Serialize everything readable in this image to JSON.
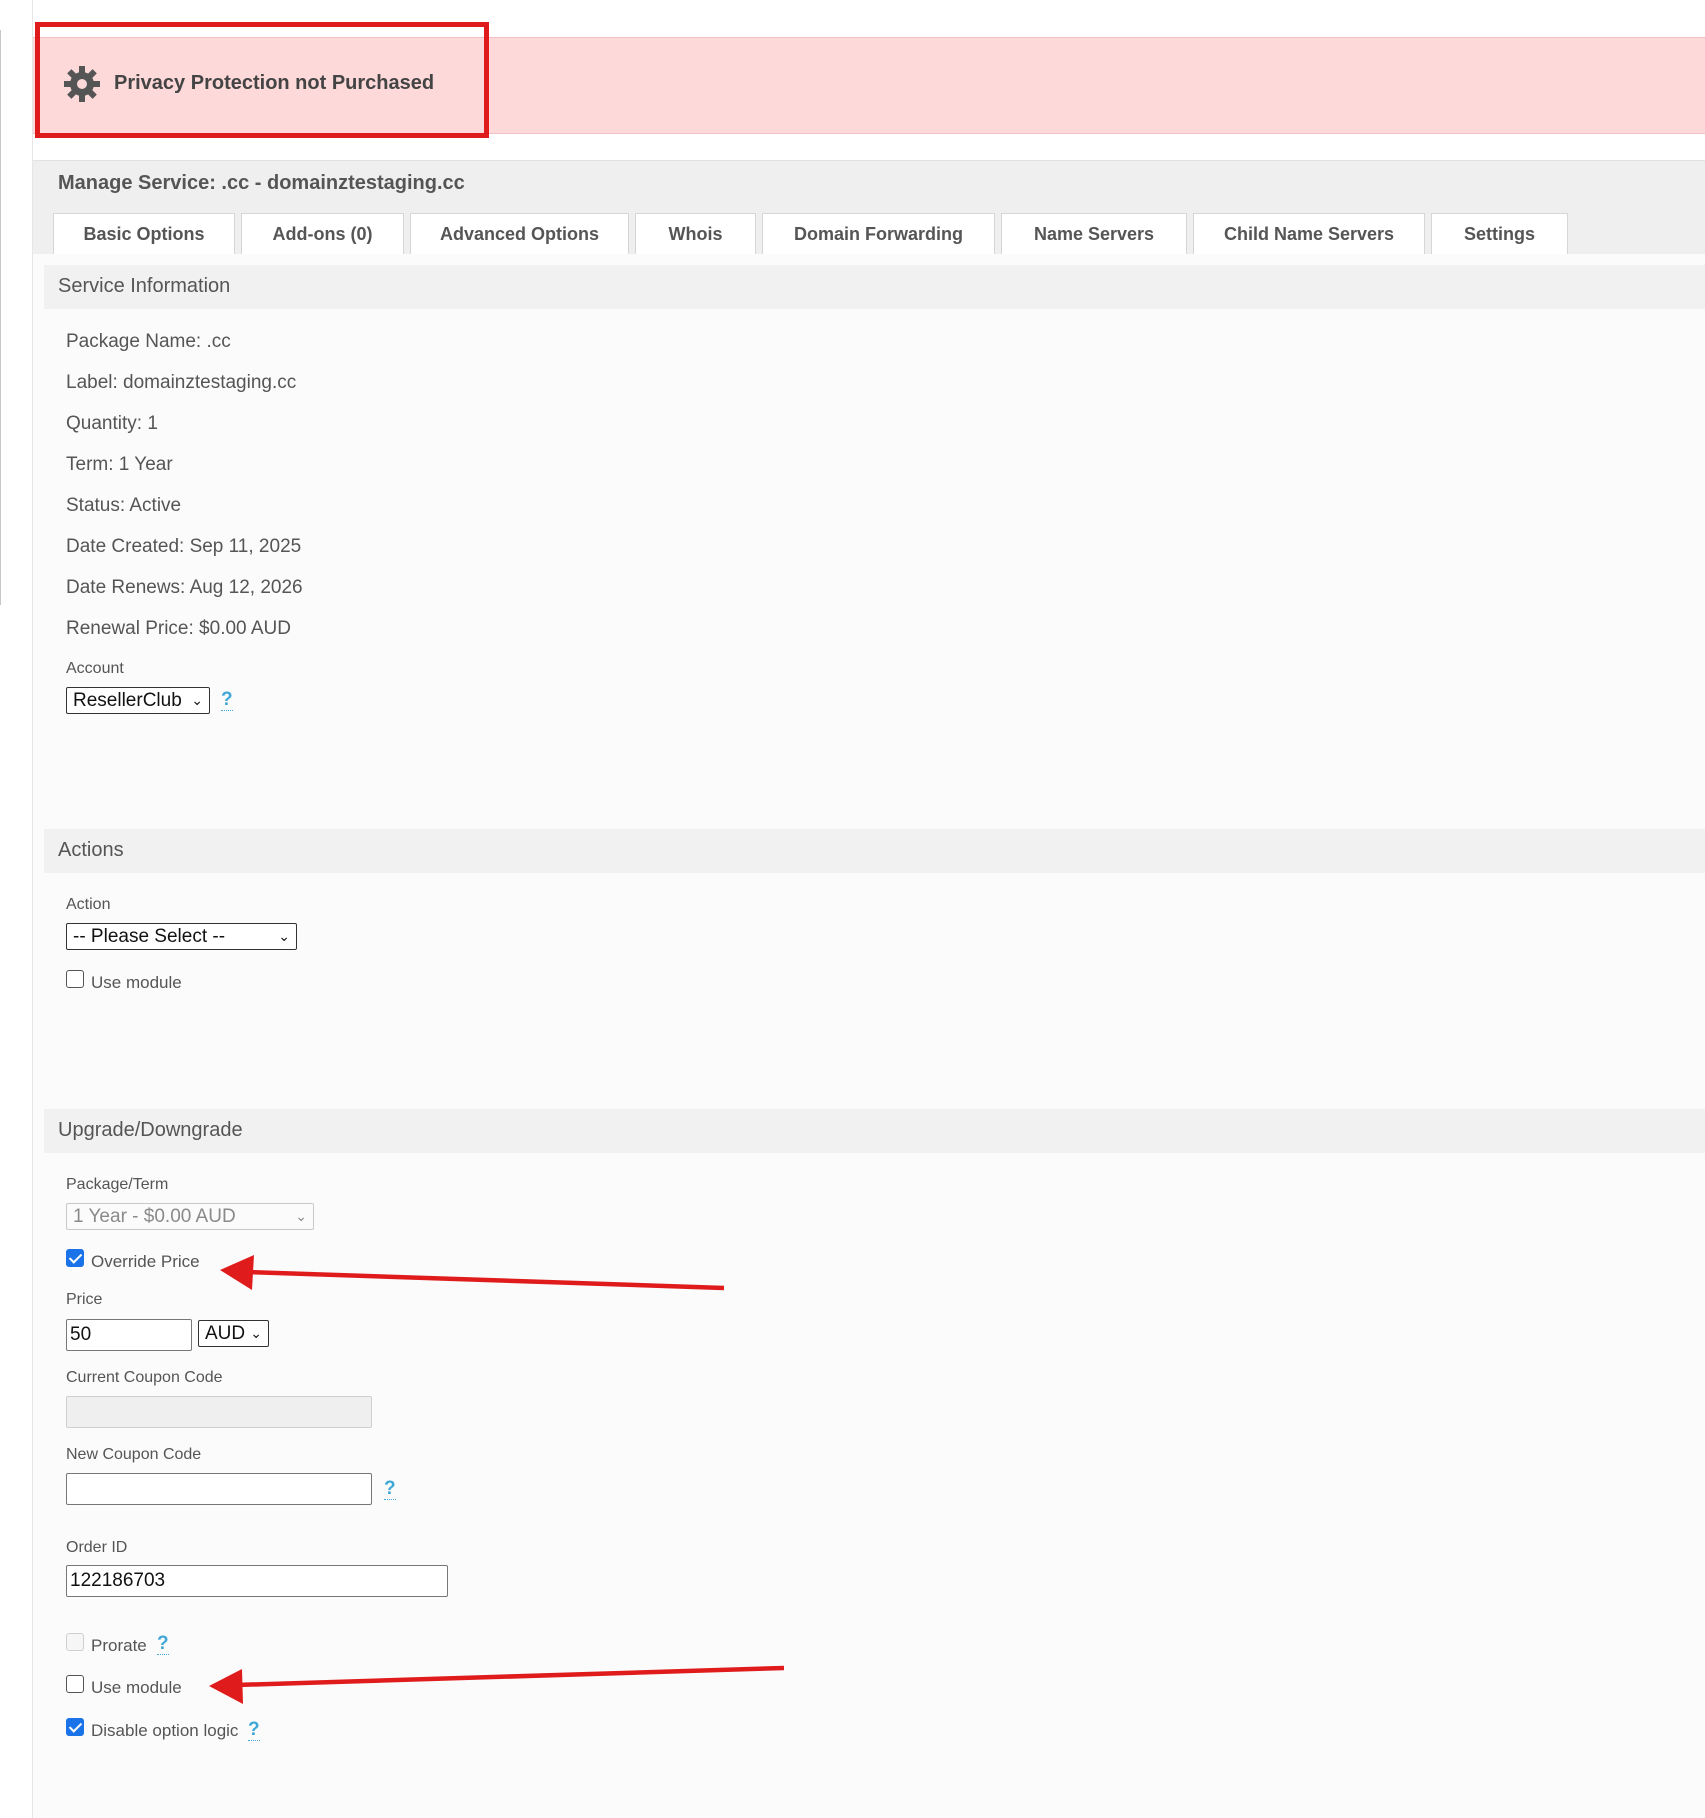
{
  "alert": {
    "text": "Privacy Protection not Purchased",
    "icon": "gear-icon",
    "color": "#fdd9d9",
    "highlight_color": "#e01b1b"
  },
  "manage": {
    "title": "Manage Service: .cc - domainztestaging.cc",
    "tabs": [
      {
        "label": "Basic Options"
      },
      {
        "label": "Add-ons (0)"
      },
      {
        "label": "Advanced Options"
      },
      {
        "label": "Whois"
      },
      {
        "label": "Domain Forwarding"
      },
      {
        "label": "Name Servers"
      },
      {
        "label": "Child Name Servers"
      },
      {
        "label": "Settings"
      }
    ]
  },
  "service_info": {
    "header": "Service Information",
    "lines": [
      "Package Name: .cc",
      "Label: domainztestaging.cc",
      "Quantity: 1",
      "Term: 1 Year",
      "Status: Active",
      "Date Created: Sep 11, 2025",
      "Date Renews: Aug 12, 2026",
      "Renewal Price: $0.00 AUD"
    ],
    "account_label": "Account",
    "account_value": "ResellerClub",
    "help": "?"
  },
  "actions": {
    "header": "Actions",
    "action_label": "Action",
    "action_value": "-- Please Select --",
    "use_module_label": "Use module",
    "use_module_checked": false
  },
  "upgrade": {
    "header": "Upgrade/Downgrade",
    "package_term_label": "Package/Term",
    "package_term_value": "1 Year - $0.00 AUD",
    "override_price_label": "Override Price",
    "override_price_checked": true,
    "price_label": "Price",
    "price_value": "50",
    "currency_value": "AUD",
    "current_coupon_label": "Current Coupon Code",
    "current_coupon_value": "",
    "new_coupon_label": "New Coupon Code",
    "new_coupon_value": "",
    "help": "?",
    "order_id_label": "Order ID",
    "order_id_value": "122186703",
    "prorate_label": "Prorate",
    "prorate_checked": false,
    "use_module_label": "Use module",
    "use_module_checked": false,
    "disable_option_logic_label": "Disable option logic",
    "disable_option_logic_checked": true
  },
  "annotation_color": "#e01b1b",
  "checkbox_color": "#1a73e8"
}
